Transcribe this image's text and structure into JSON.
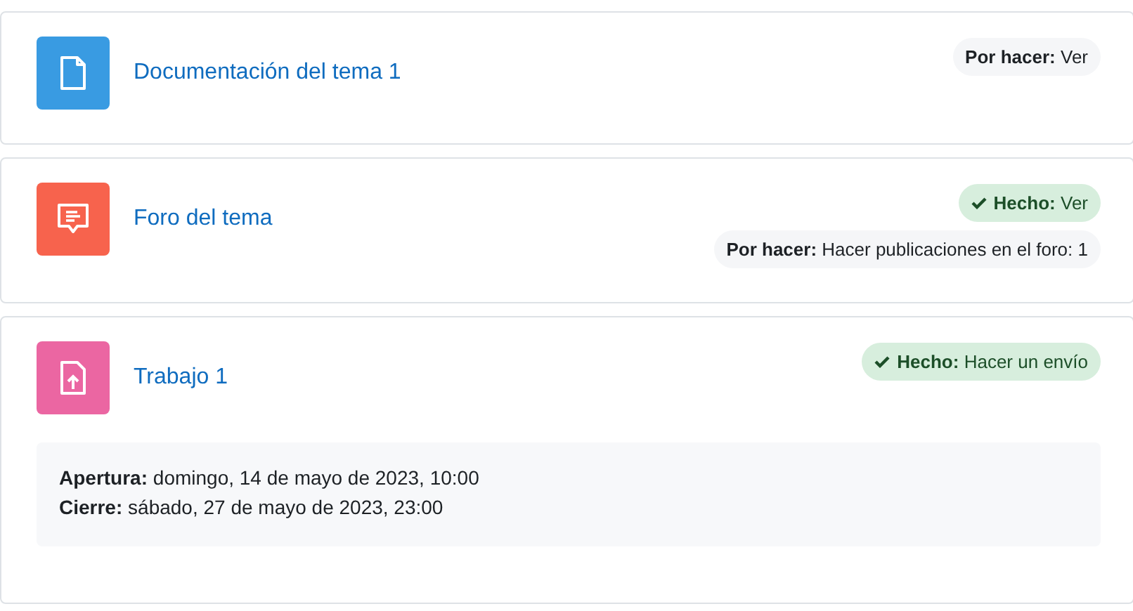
{
  "activities": [
    {
      "kind": "file",
      "title": "Documentación del tema 1",
      "completion": [
        {
          "done": false,
          "label": "Por hacer:",
          "text": "Ver"
        }
      ]
    },
    {
      "kind": "forum",
      "title": "Foro del tema",
      "completion": [
        {
          "done": true,
          "label": "Hecho:",
          "text": "Ver"
        },
        {
          "done": false,
          "label": "Por hacer:",
          "text": "Hacer publicaciones en el foro: 1"
        }
      ]
    },
    {
      "kind": "assign",
      "title": "Trabajo 1",
      "completion": [
        {
          "done": true,
          "label": "Hecho:",
          "text": "Hacer un envío"
        }
      ],
      "dates": [
        {
          "label": "Apertura:",
          "value": "domingo, 14 de mayo de 2023, 10:00"
        },
        {
          "label": "Cierre:",
          "value": "sábado, 27 de mayo de 2023, 23:00"
        }
      ]
    }
  ]
}
